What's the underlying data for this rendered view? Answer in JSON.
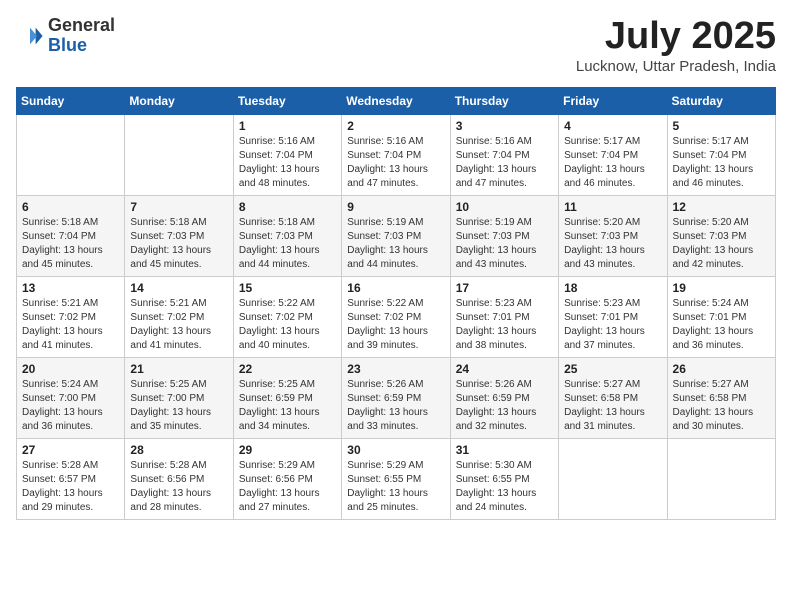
{
  "header": {
    "logo_general": "General",
    "logo_blue": "Blue",
    "month_title": "July 2025",
    "location": "Lucknow, Uttar Pradesh, India"
  },
  "weekdays": [
    "Sunday",
    "Monday",
    "Tuesday",
    "Wednesday",
    "Thursday",
    "Friday",
    "Saturday"
  ],
  "weeks": [
    [
      {
        "day": "",
        "info": ""
      },
      {
        "day": "",
        "info": ""
      },
      {
        "day": "1",
        "info": "Sunrise: 5:16 AM\nSunset: 7:04 PM\nDaylight: 13 hours and 48 minutes."
      },
      {
        "day": "2",
        "info": "Sunrise: 5:16 AM\nSunset: 7:04 PM\nDaylight: 13 hours and 47 minutes."
      },
      {
        "day": "3",
        "info": "Sunrise: 5:16 AM\nSunset: 7:04 PM\nDaylight: 13 hours and 47 minutes."
      },
      {
        "day": "4",
        "info": "Sunrise: 5:17 AM\nSunset: 7:04 PM\nDaylight: 13 hours and 46 minutes."
      },
      {
        "day": "5",
        "info": "Sunrise: 5:17 AM\nSunset: 7:04 PM\nDaylight: 13 hours and 46 minutes."
      }
    ],
    [
      {
        "day": "6",
        "info": "Sunrise: 5:18 AM\nSunset: 7:04 PM\nDaylight: 13 hours and 45 minutes."
      },
      {
        "day": "7",
        "info": "Sunrise: 5:18 AM\nSunset: 7:03 PM\nDaylight: 13 hours and 45 minutes."
      },
      {
        "day": "8",
        "info": "Sunrise: 5:18 AM\nSunset: 7:03 PM\nDaylight: 13 hours and 44 minutes."
      },
      {
        "day": "9",
        "info": "Sunrise: 5:19 AM\nSunset: 7:03 PM\nDaylight: 13 hours and 44 minutes."
      },
      {
        "day": "10",
        "info": "Sunrise: 5:19 AM\nSunset: 7:03 PM\nDaylight: 13 hours and 43 minutes."
      },
      {
        "day": "11",
        "info": "Sunrise: 5:20 AM\nSunset: 7:03 PM\nDaylight: 13 hours and 43 minutes."
      },
      {
        "day": "12",
        "info": "Sunrise: 5:20 AM\nSunset: 7:03 PM\nDaylight: 13 hours and 42 minutes."
      }
    ],
    [
      {
        "day": "13",
        "info": "Sunrise: 5:21 AM\nSunset: 7:02 PM\nDaylight: 13 hours and 41 minutes."
      },
      {
        "day": "14",
        "info": "Sunrise: 5:21 AM\nSunset: 7:02 PM\nDaylight: 13 hours and 41 minutes."
      },
      {
        "day": "15",
        "info": "Sunrise: 5:22 AM\nSunset: 7:02 PM\nDaylight: 13 hours and 40 minutes."
      },
      {
        "day": "16",
        "info": "Sunrise: 5:22 AM\nSunset: 7:02 PM\nDaylight: 13 hours and 39 minutes."
      },
      {
        "day": "17",
        "info": "Sunrise: 5:23 AM\nSunset: 7:01 PM\nDaylight: 13 hours and 38 minutes."
      },
      {
        "day": "18",
        "info": "Sunrise: 5:23 AM\nSunset: 7:01 PM\nDaylight: 13 hours and 37 minutes."
      },
      {
        "day": "19",
        "info": "Sunrise: 5:24 AM\nSunset: 7:01 PM\nDaylight: 13 hours and 36 minutes."
      }
    ],
    [
      {
        "day": "20",
        "info": "Sunrise: 5:24 AM\nSunset: 7:00 PM\nDaylight: 13 hours and 36 minutes."
      },
      {
        "day": "21",
        "info": "Sunrise: 5:25 AM\nSunset: 7:00 PM\nDaylight: 13 hours and 35 minutes."
      },
      {
        "day": "22",
        "info": "Sunrise: 5:25 AM\nSunset: 6:59 PM\nDaylight: 13 hours and 34 minutes."
      },
      {
        "day": "23",
        "info": "Sunrise: 5:26 AM\nSunset: 6:59 PM\nDaylight: 13 hours and 33 minutes."
      },
      {
        "day": "24",
        "info": "Sunrise: 5:26 AM\nSunset: 6:59 PM\nDaylight: 13 hours and 32 minutes."
      },
      {
        "day": "25",
        "info": "Sunrise: 5:27 AM\nSunset: 6:58 PM\nDaylight: 13 hours and 31 minutes."
      },
      {
        "day": "26",
        "info": "Sunrise: 5:27 AM\nSunset: 6:58 PM\nDaylight: 13 hours and 30 minutes."
      }
    ],
    [
      {
        "day": "27",
        "info": "Sunrise: 5:28 AM\nSunset: 6:57 PM\nDaylight: 13 hours and 29 minutes."
      },
      {
        "day": "28",
        "info": "Sunrise: 5:28 AM\nSunset: 6:56 PM\nDaylight: 13 hours and 28 minutes."
      },
      {
        "day": "29",
        "info": "Sunrise: 5:29 AM\nSunset: 6:56 PM\nDaylight: 13 hours and 27 minutes."
      },
      {
        "day": "30",
        "info": "Sunrise: 5:29 AM\nSunset: 6:55 PM\nDaylight: 13 hours and 25 minutes."
      },
      {
        "day": "31",
        "info": "Sunrise: 5:30 AM\nSunset: 6:55 PM\nDaylight: 13 hours and 24 minutes."
      },
      {
        "day": "",
        "info": ""
      },
      {
        "day": "",
        "info": ""
      }
    ]
  ]
}
